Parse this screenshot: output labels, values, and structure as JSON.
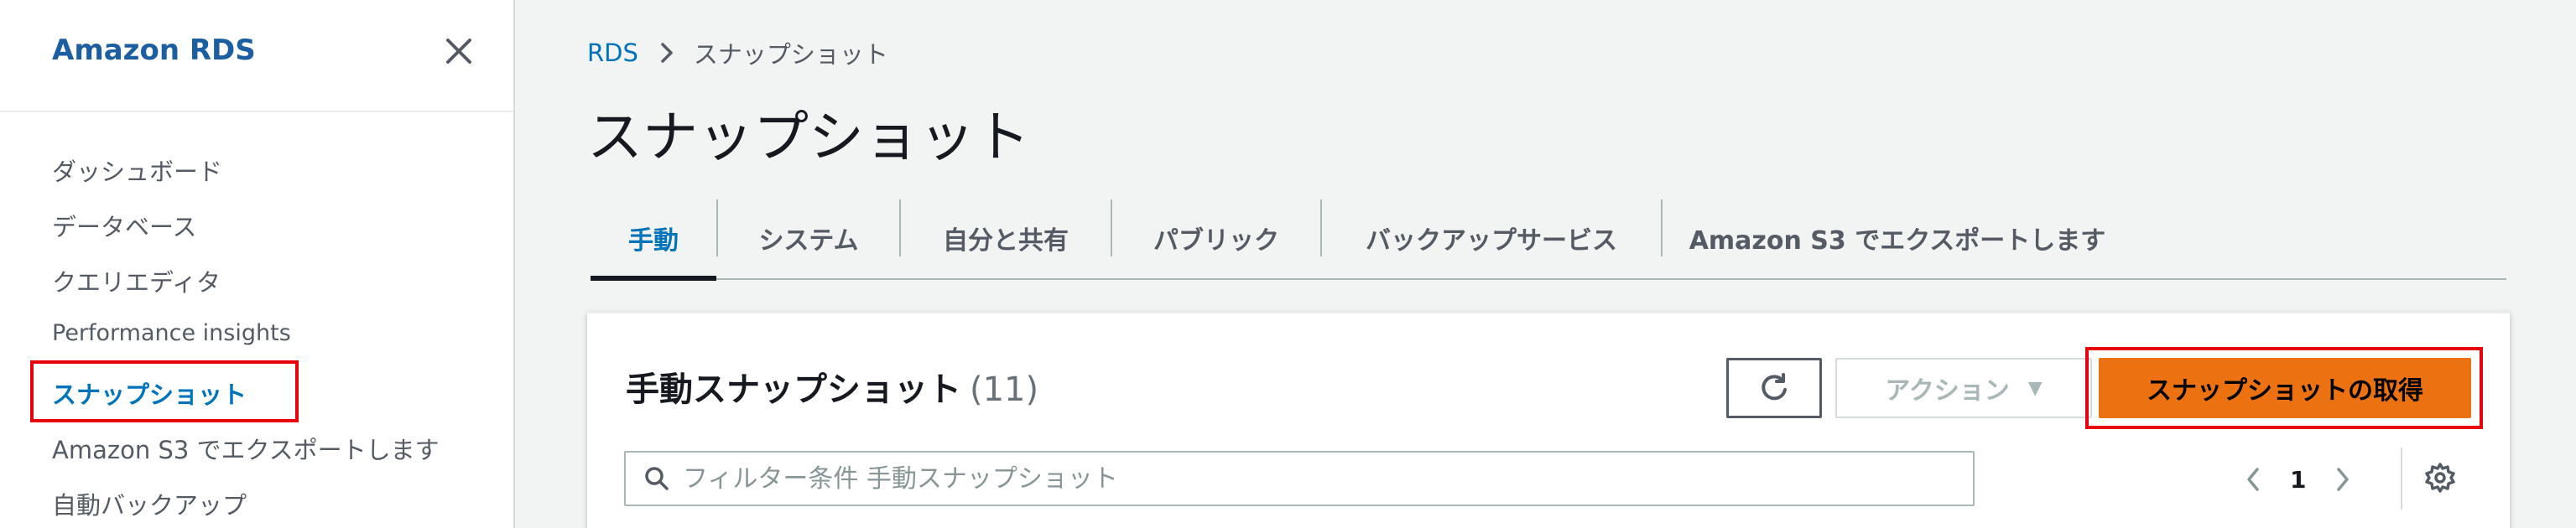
{
  "sidebar": {
    "title": "Amazon RDS",
    "items": [
      {
        "label": "ダッシュボード"
      },
      {
        "label": "データベース"
      },
      {
        "label": "クエリエディタ"
      },
      {
        "label": "Performance insights"
      },
      {
        "label": "スナップショット"
      },
      {
        "label": "Amazon S3 でエクスポートします"
      },
      {
        "label": "自動バックアップ"
      }
    ],
    "active_item": "スナップショット"
  },
  "breadcrumb": {
    "root": "RDS",
    "current": "スナップショット"
  },
  "page": {
    "title": "スナップショット"
  },
  "tabs": [
    {
      "label": "手動"
    },
    {
      "label": "システム"
    },
    {
      "label": "自分と共有"
    },
    {
      "label": "パブリック"
    },
    {
      "label": "バックアップサービス"
    },
    {
      "label": "Amazon S3 でエクスポートします"
    }
  ],
  "active_tab": "手動",
  "panel": {
    "title": "手動スナップショット",
    "count": "(11)",
    "actions_label": "アクション",
    "take_snapshot_label": "スナップショットの取得",
    "filter_placeholder": "フィルター条件 手動スナップショット",
    "current_page": "1"
  },
  "colors": {
    "accent_link": "#0073bb",
    "primary_button": "#ec7211",
    "highlight_box": "#e8000b"
  },
  "icons": [
    "close-icon",
    "chevron-right-icon",
    "refresh-icon",
    "caret-down-icon",
    "search-icon",
    "chevron-left-icon",
    "gear-icon"
  ]
}
